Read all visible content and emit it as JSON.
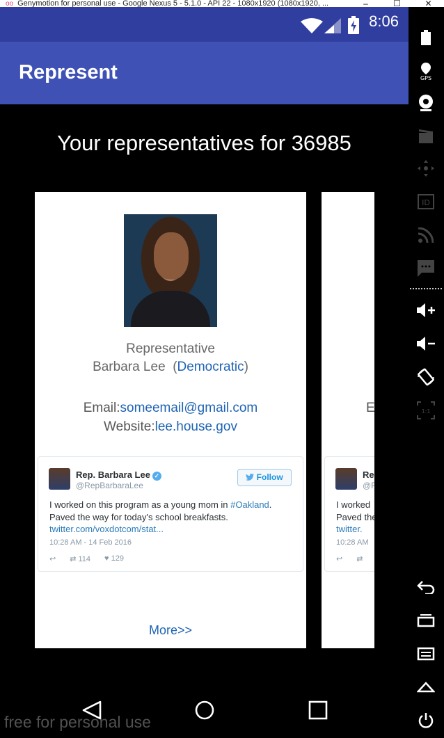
{
  "window": {
    "title": "Genymotion for personal use - Google Nexus 5 - 5.1.0 - API 22 - 1080x1920 (1080x1920, ...",
    "controls": [
      "–",
      "☐",
      "✕"
    ]
  },
  "status_bar": {
    "time": "8:06"
  },
  "app_bar": {
    "title": "Represent"
  },
  "heading": "Your representatives for 36985",
  "card": {
    "role": "Representative",
    "name": "Barbara Lee",
    "party": "Democratic",
    "email_label": "Email:",
    "email": "someemail@gmail.com",
    "website_label": "Website:",
    "website": "lee.house.gov",
    "more": "More>>"
  },
  "tweet": {
    "name": "Rep. Barbara Lee",
    "handle": "@RepBarbaraLee",
    "follow": "Follow",
    "text_before": "I worked on this program as a young mom in ",
    "hashtag": "#Oakland",
    "text_after": ".",
    "text_line2": "Paved the way for today's school breakfasts.",
    "url": "twitter.com/voxdotcom/stat...",
    "date": "10:28 AM - 14 Feb 2016",
    "retweets": "114",
    "likes": "129"
  },
  "card2": {
    "email_fragment": "E",
    "tweet_name_fragment": "Re",
    "tweet_handle_fragment": "@R",
    "tweet_text_fragment": "I worked",
    "tweet_text2_fragment": "Paved the",
    "tweet_url_fragment": "twitter.",
    "tweet_date_fragment": "10:28 AM"
  },
  "watermark": "free for personal use",
  "sidebar_icons": [
    "battery-icon",
    "gps-icon",
    "camera-icon",
    "video-icon",
    "dpad-icon",
    "id-icon",
    "rss-icon",
    "sms-icon",
    "volume-up-icon",
    "volume-down-icon",
    "rotate-icon",
    "scale-icon",
    "back-icon",
    "recents-icon",
    "menu-icon",
    "home-icon",
    "power-icon"
  ],
  "sidebar_labels": {
    "gps": "GPS",
    "id": "ID",
    "scale": "1:1"
  }
}
